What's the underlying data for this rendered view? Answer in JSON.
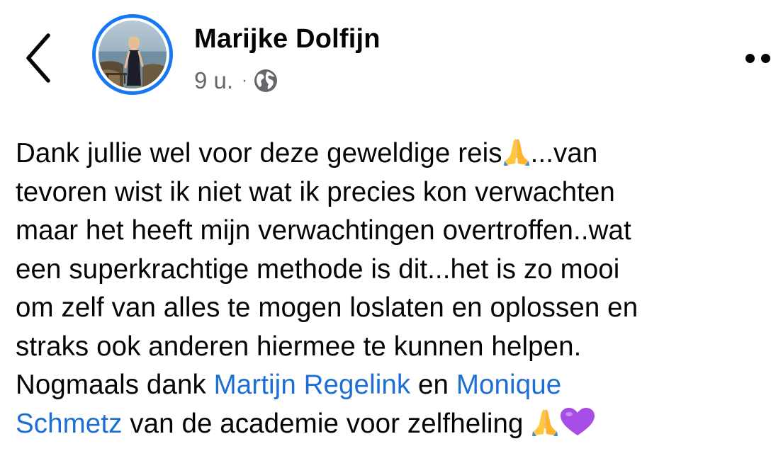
{
  "header": {
    "author_name": "Marijke Dolfijn",
    "timestamp": "9 u.",
    "separator": "·",
    "privacy_icon": "globe-icon",
    "back_icon": "chevron-left-icon",
    "more_icon": "more-options-icon",
    "ring_color": "#1877f2"
  },
  "post": {
    "line1_a": "Dank jullie wel voor deze geweldige reis",
    "line1_b": "...van",
    "line2": "tevoren wist ik niet wat ik precies kon verwachten",
    "line3": "maar het heeft mijn verwachtingen overtroffen..wat",
    "line4": "een superkrachtige methode is dit...het is zo mooi",
    "line5": "om zelf van alles te mogen loslaten en oplossen en",
    "line6": "straks ook anderen hiermee te kunnen helpen.",
    "line7_a": "Nogmaals dank ",
    "mention1": "Martijn Regelink",
    "line7_b": " en ",
    "mention2_part1": "Monique",
    "mention2_part2": "Schmetz",
    "line8_b": " van de academie voor zelfheling ",
    "emojis": [
      "folded-hands-emoji",
      "purple-heart-emoji"
    ],
    "link_color": "#1d6fd6"
  }
}
